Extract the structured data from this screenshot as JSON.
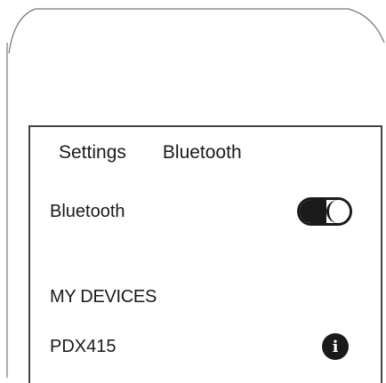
{
  "nav": {
    "back_label": "Settings",
    "title": "Bluetooth"
  },
  "bluetooth_row": {
    "label": "Bluetooth",
    "toggle_state": "on"
  },
  "devices_section": {
    "header": "MY DEVICES",
    "items": [
      {
        "name": "PDX415",
        "icon": "info-icon"
      }
    ]
  },
  "colors": {
    "foreground": "#1a1a1a",
    "background": "#ffffff",
    "bezel": "#444444"
  }
}
